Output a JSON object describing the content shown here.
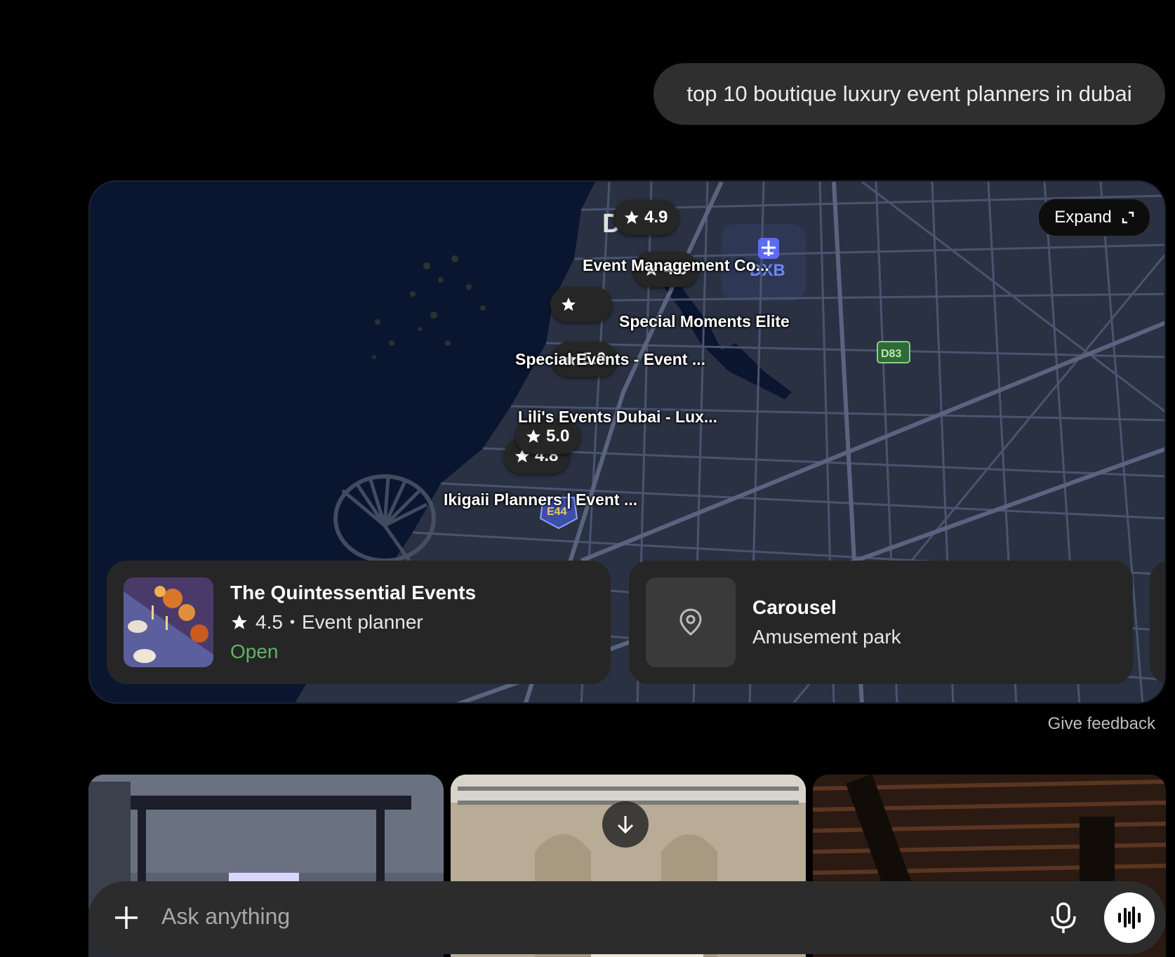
{
  "user_message": "top 10 boutique luxury event planners in dubai",
  "map": {
    "expand_label": "Expand",
    "pins": [
      {
        "rating": "4.9"
      },
      {
        "rating": "4.9"
      },
      {
        "rating": "5.0"
      },
      {
        "rating": "5.0"
      },
      {
        "rating": "4.8"
      }
    ],
    "labels": [
      "Event Management Co...",
      "Special Moments Elite",
      "Special Events - Event ...",
      "Lili's Events Dubai - Lux...",
      "Ikigaii Planners | Event ..."
    ],
    "airport_code": "DXB",
    "road_badges": [
      "D83",
      "E44"
    ],
    "city_letter": "D"
  },
  "places": [
    {
      "title": "The Quintessential Events",
      "rating": "4.5",
      "separator": "•",
      "category": "Event planner",
      "status": "Open"
    },
    {
      "title": "Carousel",
      "category": "Amusement park"
    }
  ],
  "feedback_label": "Give feedback",
  "composer": {
    "placeholder": "Ask anything"
  },
  "colors": {
    "open_status": "#5fb36b",
    "map_bg": "#2a3142",
    "water": "#0a1530"
  }
}
